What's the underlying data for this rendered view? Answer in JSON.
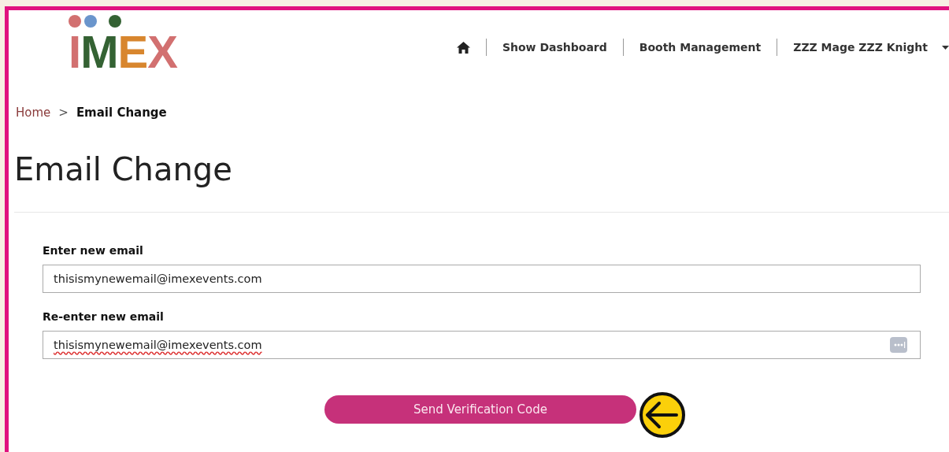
{
  "logo": {
    "text": "IMEX"
  },
  "nav": {
    "items": [
      {
        "label": "Show Dashboard"
      },
      {
        "label": "Booth Management"
      }
    ],
    "user": "ZZZ Mage ZZZ Knight"
  },
  "breadcrumb": [
    {
      "label": "Home",
      "current": false
    },
    {
      "label": "Email Change",
      "current": true
    }
  ],
  "breadcrumb_separator": ">",
  "title": "Email Change",
  "fields": [
    {
      "label": "Enter new email",
      "value": "thisismynewemail@imexevents.com",
      "misspelled": false,
      "autofill_icon": false
    },
    {
      "label": "Re-enter new email",
      "value": "thisismynewemail@imexevents.com",
      "misspelled": true,
      "autofill_icon": true
    }
  ],
  "button": "Send Verification Code"
}
